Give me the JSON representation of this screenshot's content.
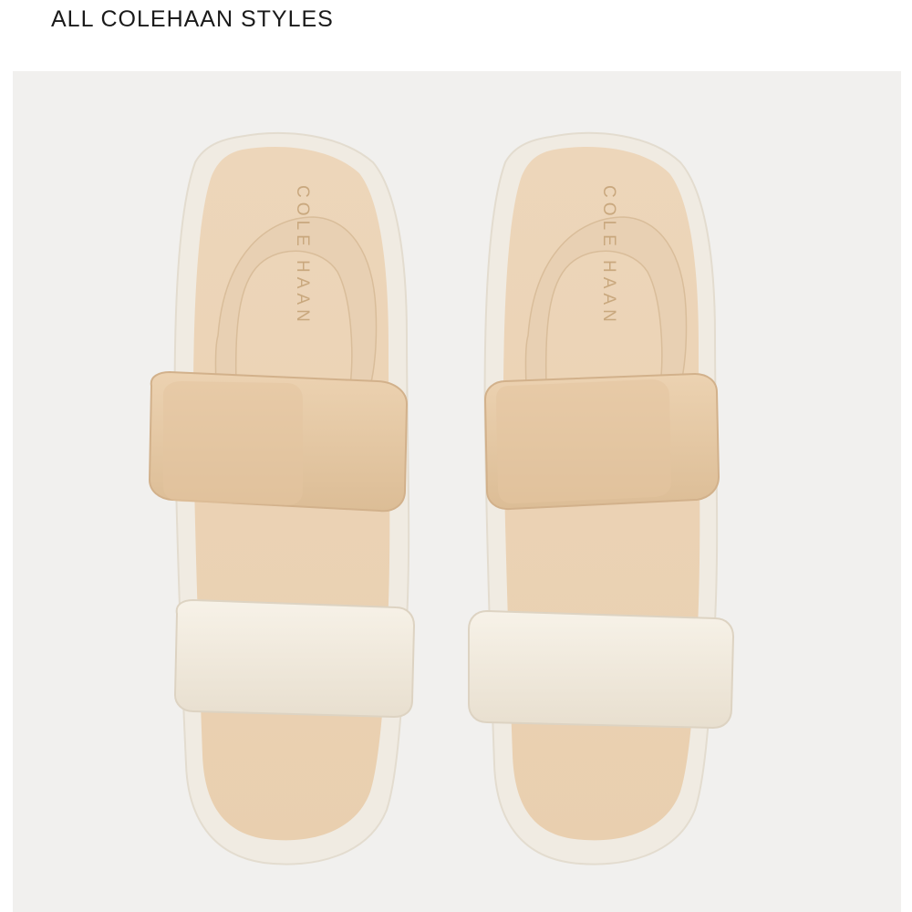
{
  "header": {
    "link_label": "ALL COLEHAAN STYLES"
  },
  "product": {
    "footbed_brand_left": "COLE HAAN",
    "footbed_brand_right": "COLE HAAN"
  },
  "colors": {
    "background": "#f1f0ee",
    "sole": "#f0ebe2",
    "footbed": "#ebd3b6",
    "strap_tan": "#e6c9a4",
    "strap_white": "#f3ede0",
    "brand_print": "#c9a87e"
  }
}
